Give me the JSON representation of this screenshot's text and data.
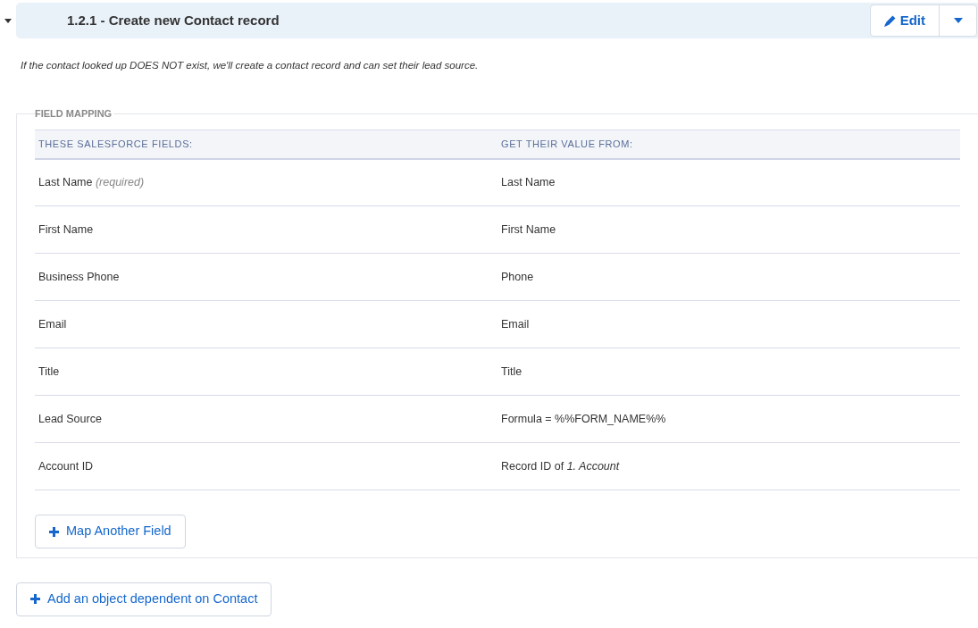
{
  "header": {
    "expanded": true,
    "title": "1.2.1 - Create new Contact record",
    "edit_button": "Edit"
  },
  "description": "If the contact looked up DOES NOT exist, we'll create a contact record and can set their lead source.",
  "field_mapping": {
    "legend": "FIELD MAPPING",
    "columns": [
      "THESE SALESFORCE FIELDS:",
      "GET THEIR VALUE FROM:"
    ],
    "rows": [
      {
        "field": "Last Name *(required)*",
        "value": "Last Name"
      },
      {
        "field": "First Name",
        "value": "First Name"
      },
      {
        "field": "Business Phone",
        "value": "Phone"
      },
      {
        "field": "Email",
        "value": "Email"
      },
      {
        "field": "Title",
        "value": "Title"
      },
      {
        "field": "Lead Source",
        "value": "Formula = %%FORM_NAME%%"
      },
      {
        "field": "Account ID",
        "value": "Record ID of *1. Account*"
      }
    ],
    "add_button": "Map Another Field"
  },
  "add_object_button": "Add an object dependent on Contact"
}
